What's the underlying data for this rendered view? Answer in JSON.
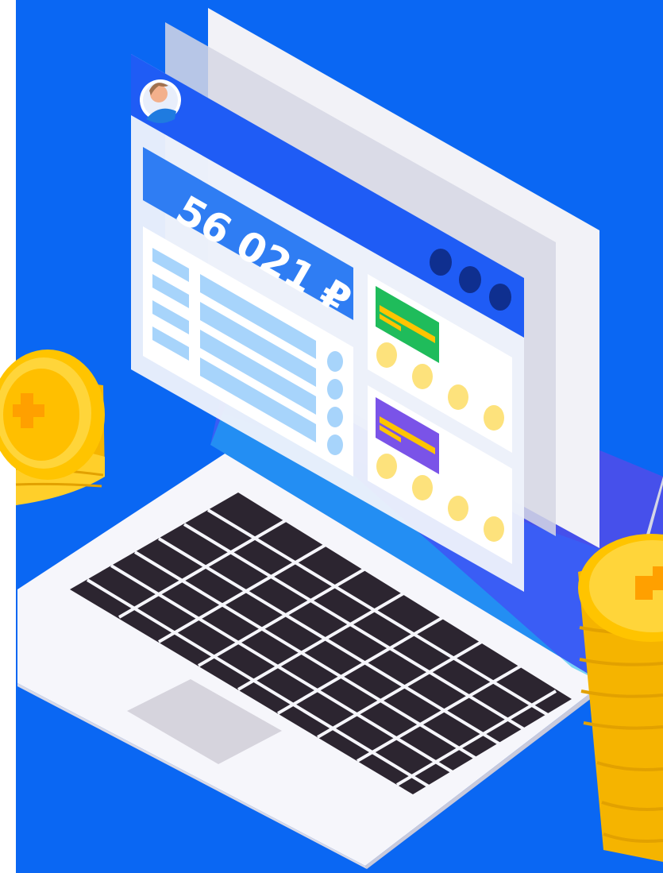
{
  "dashboard": {
    "balance": "56 021 ₽"
  },
  "colors": {
    "background": "#0a67f3",
    "panel": "#edf1fb",
    "header": "#1f5cf5",
    "accent_green": "#1fbc5b",
    "accent_purple": "#7a53e8",
    "coin": "#ffc400",
    "keyboard_key": "#352d38"
  },
  "icons": {
    "avatar": "user-avatar-icon",
    "menu": "three-dots-icon"
  }
}
